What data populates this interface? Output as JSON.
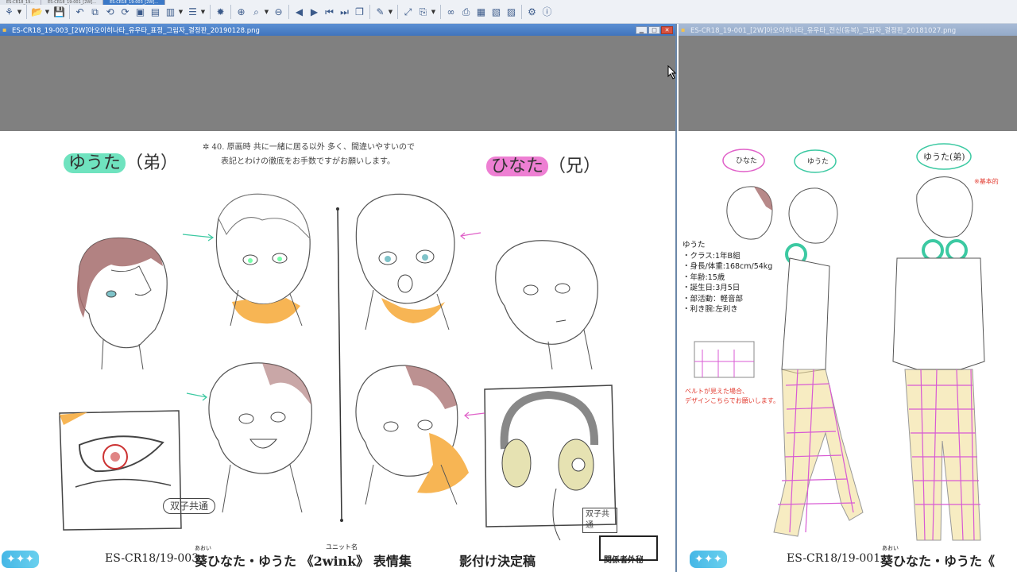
{
  "toolbar": {
    "buttons": [
      {
        "name": "tree-icon",
        "glyph": "⚘",
        "drop": true
      },
      {
        "name": "open-folder-icon",
        "glyph": "📂",
        "drop": true
      },
      {
        "name": "save-icon",
        "glyph": "💾",
        "drop": false
      },
      {
        "name": "undo-icon",
        "glyph": "↶",
        "drop": false
      },
      {
        "name": "crop-icon",
        "glyph": "⧉",
        "drop": false
      },
      {
        "name": "rotate-left-icon",
        "glyph": "⟲",
        "drop": false
      },
      {
        "name": "rotate-right-icon",
        "glyph": "⟳",
        "drop": false
      },
      {
        "name": "image-icon",
        "glyph": "▣",
        "drop": false
      },
      {
        "name": "slideshow-icon",
        "glyph": "▤",
        "drop": false
      },
      {
        "name": "batch-icon",
        "glyph": "▥",
        "drop": true
      },
      {
        "name": "properties-icon",
        "glyph": "☰",
        "drop": true
      },
      {
        "name": "effects-icon",
        "glyph": "✹",
        "drop": false
      },
      {
        "name": "zoom-in-icon",
        "glyph": "⊕",
        "drop": false
      },
      {
        "name": "zoom-icon",
        "glyph": "⌕",
        "drop": true
      },
      {
        "name": "zoom-out-icon",
        "glyph": "⊖",
        "drop": false
      },
      {
        "name": "prev-icon",
        "glyph": "◀",
        "drop": false
      },
      {
        "name": "next-icon",
        "glyph": "▶",
        "drop": false
      },
      {
        "name": "first-icon",
        "glyph": "⏮",
        "drop": false
      },
      {
        "name": "last-icon",
        "glyph": "⏭",
        "drop": false
      },
      {
        "name": "window-icon",
        "glyph": "❐",
        "drop": false
      },
      {
        "name": "paint-icon",
        "glyph": "✎",
        "drop": true
      },
      {
        "name": "fit-icon",
        "glyph": "⤢",
        "drop": false
      },
      {
        "name": "copy-icon",
        "glyph": "⎘",
        "drop": true
      },
      {
        "name": "binoculars-icon",
        "glyph": "∞",
        "drop": false
      },
      {
        "name": "print-icon",
        "glyph": "⎙",
        "drop": false
      },
      {
        "name": "scan-icon",
        "glyph": "▦",
        "drop": false
      },
      {
        "name": "wallpaper-icon",
        "glyph": "▧",
        "drop": false
      },
      {
        "name": "capture-icon",
        "glyph": "▨",
        "drop": false
      },
      {
        "name": "settings-icon",
        "glyph": "⚙",
        "drop": false
      },
      {
        "name": "info-icon",
        "glyph": "ⓘ",
        "drop": false
      }
    ]
  },
  "tabs": [
    "ES-CR18_19...",
    "ES-CR18_19-001_[2W]...",
    "ES-CR18_19-003_[2W]..."
  ],
  "windows": {
    "left": {
      "title": "ES-CR18_19-003_[2W]아오이히나타_유우타_표정_그림자_결정판_20190128.png",
      "min": "▁",
      "max": "□",
      "close": "✕"
    },
    "right": {
      "title": "ES-CR18_19-001_[2W]아오이히나타_유우타_전신(동복)_그림자_결정판_20181027.png"
    }
  },
  "sheet_left": {
    "name_yuta": "ゆうた",
    "name_yuta_paren": "（弟）",
    "name_hinata": "ひなた",
    "name_hinata_paren": "（兄）",
    "note_line1": "✲ 40. 原画時 共に一緒に居る以外 多く、間違いやすいので",
    "note_line2": "表記とわけの徹底をお手数ですがお願いします。",
    "badge": "双子共通",
    "badge2": "双子共通",
    "footer_code": "ES-CR18/19-003",
    "footer_ruby": "あおい",
    "footer_unit_ruby": "ユニット名",
    "footer_title": "葵ひなた・ゆうた 《2wink》 表情集",
    "footer_sub": "影付け決定稿",
    "footer_box": "関係者外秘"
  },
  "sheet_right": {
    "tag_hinata": "ひなた",
    "tag_yuta": "ゆうた",
    "tag_yuta_big": "ゆうた(弟)",
    "red_corner": "※基本的",
    "profile": [
      "ゆうた",
      "・クラス:1年B組",
      "・身長/体重:168cm/54kg",
      "・年齢:15歳",
      "・誕生日:3月5日",
      "・部活動：軽音部",
      "・利き腕:左利き"
    ],
    "belt_note_1": "ベルトが見えた場合、",
    "belt_note_2": "デザインこちらでお願いします。",
    "footer_code": "ES-CR18/19-001",
    "footer_ruby": "あおい",
    "footer_title": "葵ひなた・ゆうた《"
  },
  "colors": {
    "green_highlight": "#6fe3bf",
    "pink_highlight": "#ee7fd3",
    "skin_shadow": "#f7b554",
    "hair_shadow": "#a56c6c",
    "plaid_pink": "#d85ad4",
    "plaid_yellow": "#f3e09b"
  }
}
